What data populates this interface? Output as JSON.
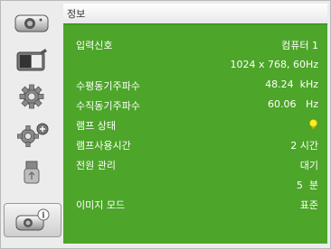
{
  "header": {
    "title": "정보"
  },
  "rows": [
    {
      "label": "입력신호",
      "value": "컴퓨터 1"
    },
    {
      "label": "",
      "value": "1024 x 768, 60Hz"
    },
    {
      "label": "수평동기주파수",
      "value": "48.24  kHz"
    },
    {
      "label": "수직동기주파수",
      "value": "60.06   Hz"
    },
    {
      "label": "램프 상태",
      "value": ""
    },
    {
      "label": "램프사용시간",
      "value": "2 시간"
    },
    {
      "label": "전원 관리",
      "value": "대기"
    },
    {
      "label": "",
      "value": "5  분"
    },
    {
      "label": "이미지 모드",
      "value": "표준"
    }
  ],
  "sidebar": {
    "tabs": [
      {
        "icon": "display-settings-icon"
      },
      {
        "icon": "image-adjust-icon"
      },
      {
        "icon": "gear-icon"
      },
      {
        "icon": "advanced-gear-icon"
      },
      {
        "icon": "usb-icon"
      },
      {
        "icon": "info-icon"
      }
    ]
  },
  "colors": {
    "panel_bg": "#4da52a",
    "lamp": "#ffee22"
  }
}
